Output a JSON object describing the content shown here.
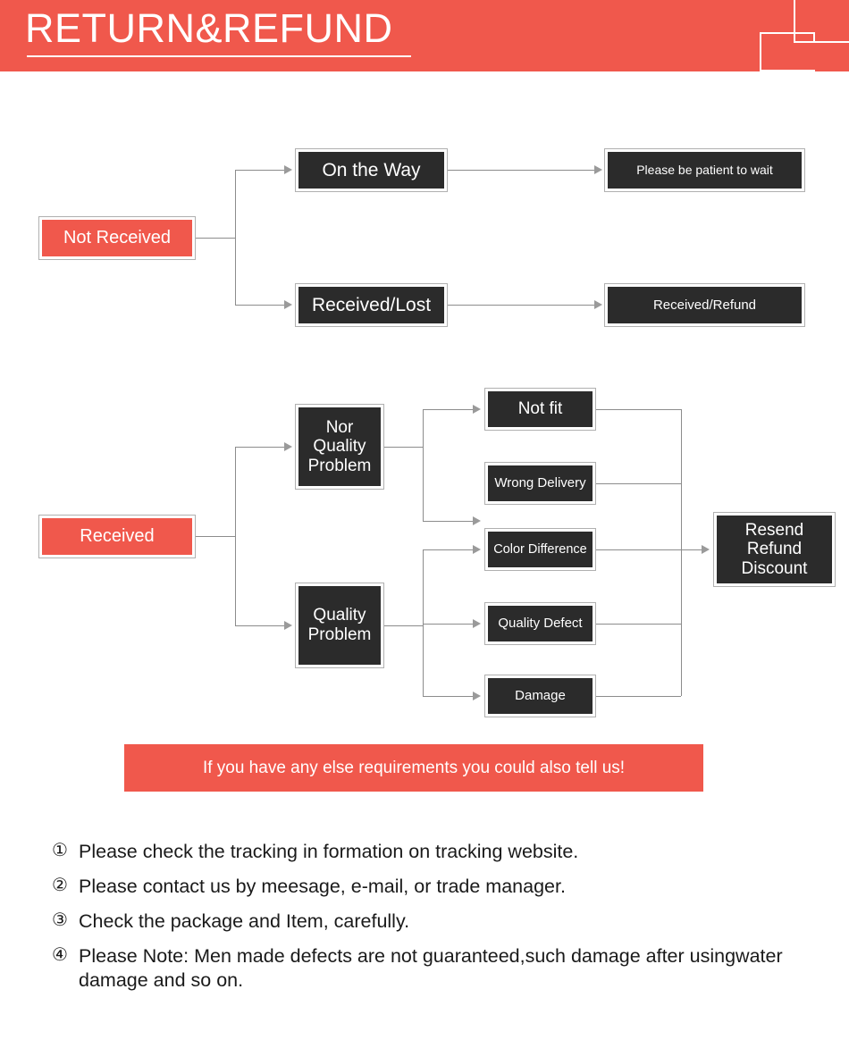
{
  "header": {
    "title": "RETURN&REFUND"
  },
  "flow": {
    "not_received": {
      "source": "Not Received",
      "branches": [
        {
          "stage": "On the Way",
          "result": "Please be patient to wait"
        },
        {
          "stage": "Received/Lost",
          "result": "Received/Refund"
        }
      ]
    },
    "received": {
      "source": "Received",
      "categories": [
        {
          "label": "Nor\nQuality\nProblem",
          "line1": "Nor",
          "line2": "Quality",
          "line3": "Problem"
        },
        {
          "label": "Quality\nProblem",
          "line1": "Quality",
          "line2": "Problem"
        }
      ],
      "reasons": [
        "Not fit",
        "Wrong Delivery",
        "Color Difference",
        "Quality Defect",
        "Damage"
      ],
      "outcome": {
        "line1": "Resend",
        "line2": "Refund",
        "line3": "Discount"
      }
    }
  },
  "cta": {
    "text": "If you have any else requirements you could also tell us!"
  },
  "notes": [
    {
      "num": "①",
      "text": "Please check the tracking in formation on tracking website."
    },
    {
      "num": "②",
      "text": "Please contact us by meesage, e-mail, or trade manager."
    },
    {
      "num": "③",
      "text": "Check the package and Item, carefully."
    },
    {
      "num": "④",
      "text": "Please Note: Men made defects are not guaranteed,such damage after usingwater damage and so on."
    }
  ],
  "colors": {
    "brand_red": "#f0584c",
    "box_dark": "#2b2b2b",
    "box_border": "#b0b0b0",
    "connector": "#8c8c8c"
  }
}
